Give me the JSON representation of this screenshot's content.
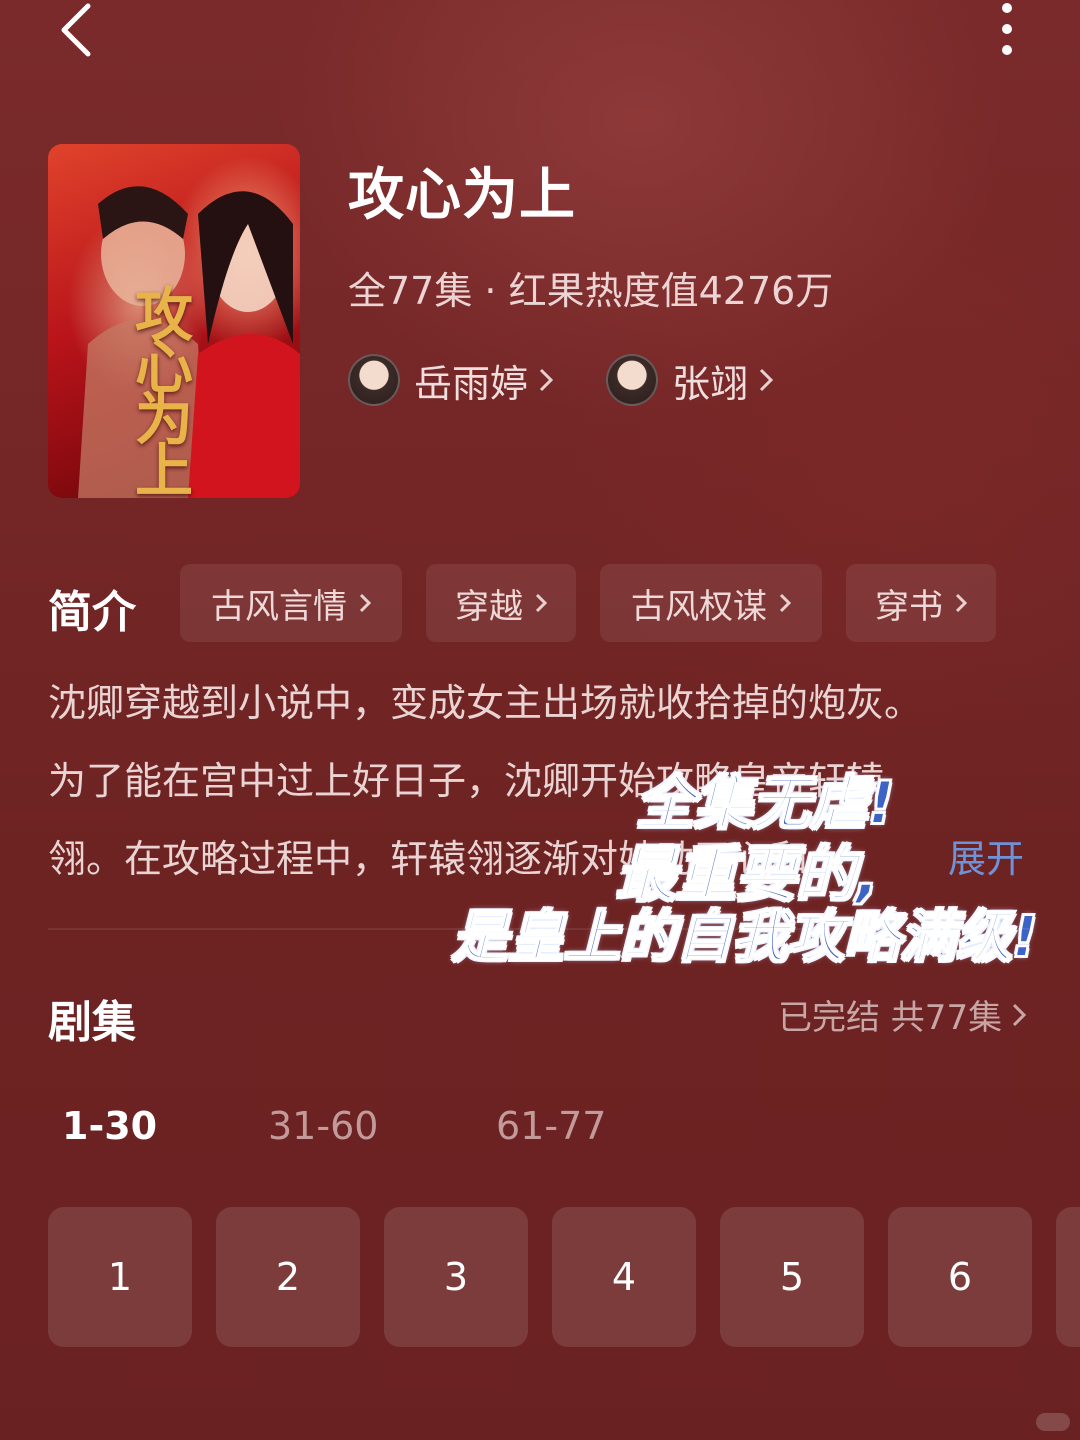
{
  "top_bar": {
    "back_icon": "back-arrow-icon",
    "more_icon": "more-vertical-icon"
  },
  "poster": {
    "title_art": "攻心为上"
  },
  "show": {
    "title": "攻心为上",
    "meta": "全77集 · 红果热度值4276万",
    "actors": [
      {
        "name": "岳雨婷"
      },
      {
        "name": "张翊"
      }
    ]
  },
  "intro": {
    "heading": "简介",
    "tags": [
      {
        "label": "古风言情"
      },
      {
        "label": "穿越"
      },
      {
        "label": "古风权谋"
      },
      {
        "label": "穿书"
      }
    ],
    "lines": [
      "沈卿穿越到小说中，变成女主出场就收拾掉的炮灰。",
      "为了能在宫中过上好日子，沈卿开始攻略皇帝轩辕",
      "翎。在攻略过程中，轩辕翎逐渐对她动了心和..."
    ],
    "expand_label": "展开"
  },
  "overlay_caption": {
    "line1": "全集无虐!",
    "line2": "最重要的,",
    "line3": "是皇上的自我攻略满级!"
  },
  "episodes": {
    "heading": "剧集",
    "status": "已完结 共77集",
    "ranges": [
      {
        "label": "1-30",
        "active": true
      },
      {
        "label": "31-60",
        "active": false
      },
      {
        "label": "61-77",
        "active": false
      }
    ],
    "buttons": [
      "1",
      "2",
      "3",
      "4",
      "5",
      "6"
    ]
  },
  "colors": {
    "background": "#6e2424",
    "accent_link": "#6f93d8",
    "overlay_text": "#3e63c7"
  }
}
